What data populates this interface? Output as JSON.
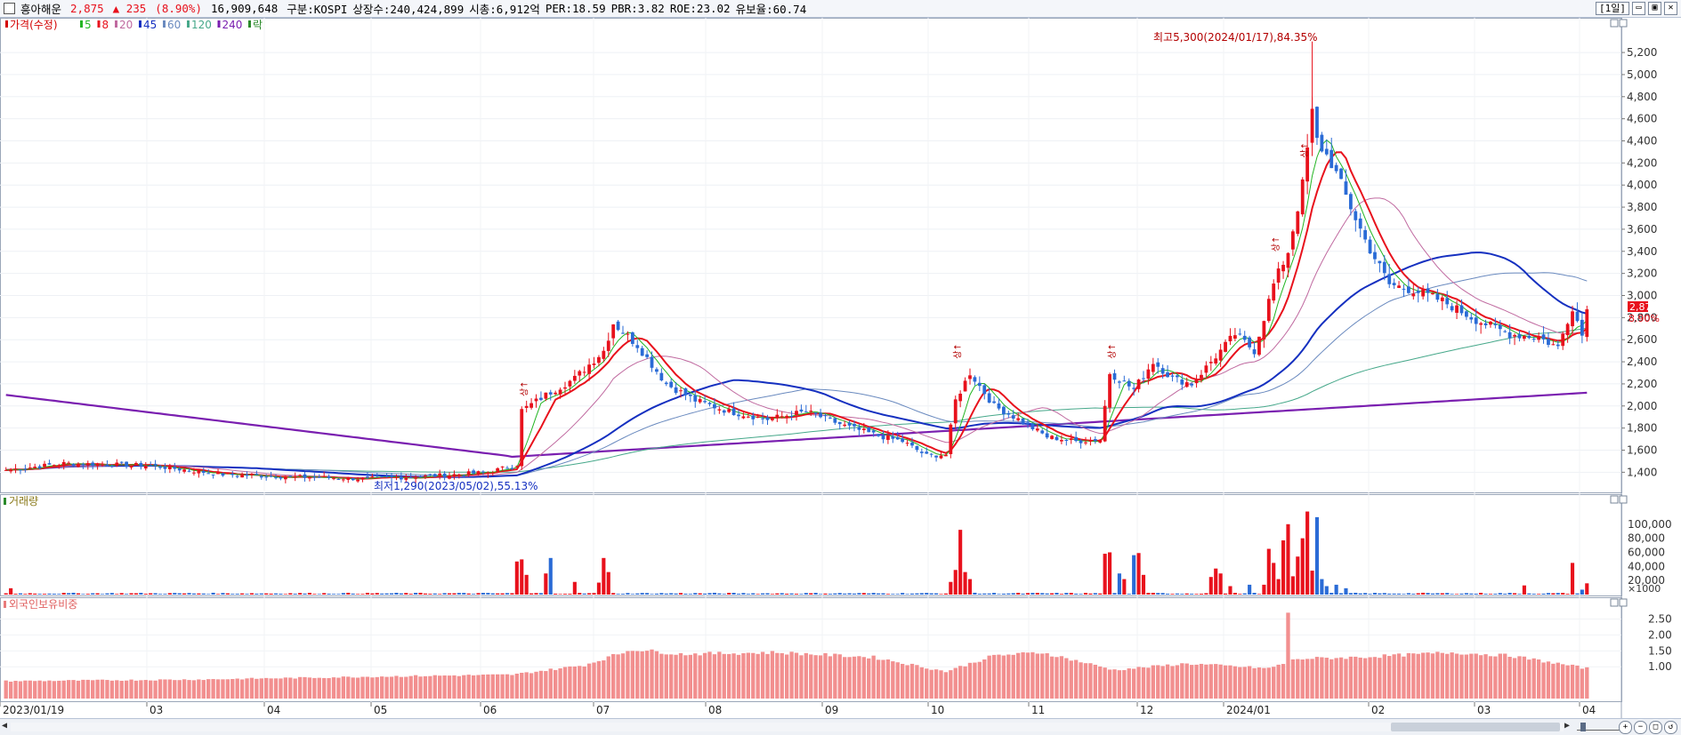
{
  "header": {
    "stock_name": "흥아해운",
    "price": "2,875",
    "change": "▲ 235",
    "change_pct": "(8.90%)",
    "volume": "16,909,648",
    "market": "구분:KOSPI",
    "shares": "상장수:240,424,899",
    "market_cap": "시총:6,912억",
    "per": "PER:18.59",
    "pbr": "PBR:3.82",
    "roe": "ROE:23.02",
    "float_ratio": "유보율:60.74",
    "timeframe": "[1일]",
    "window_buttons": [
      "▭",
      "▣",
      "✕"
    ]
  },
  "legend": {
    "items": [
      {
        "label": "가격(수정)",
        "color": "#d40000"
      },
      {
        "label": "5",
        "color": "#23b523"
      },
      {
        "label": "8",
        "color": "#e8111c"
      },
      {
        "label": "20",
        "color": "#c06aa0"
      },
      {
        "label": "45",
        "color": "#1530c0"
      },
      {
        "label": "60",
        "color": "#6a8abf"
      },
      {
        "label": "120",
        "color": "#46a88a"
      },
      {
        "label": "240",
        "color": "#7a1fb0"
      },
      {
        "label": "락",
        "color": "#2b8a2b"
      }
    ]
  },
  "annotations": {
    "high": "최고5,300(2024/01/17),84.35%",
    "low": "최저1,290(2023/05/02),55.13%",
    "limit_up": "상↑"
  },
  "last_price": {
    "price": "2,875",
    "pct": "8.90%"
  },
  "panels": {
    "volume_title": "거래량",
    "foreign_title": "외국인보유비중",
    "volume_unit": "×1000"
  },
  "x_axis": {
    "labels": [
      "2023/01/19",
      "03",
      "04",
      "05",
      "06",
      "07",
      "08",
      "09",
      "10",
      "11",
      "12",
      "2024/01",
      "02",
      "03",
      "04"
    ]
  },
  "price_axis": {
    "labels": [
      "5,200",
      "5,000",
      "4,800",
      "4,600",
      "4,400",
      "4,200",
      "4,000",
      "3,800",
      "3,600",
      "3,400",
      "3,200",
      "3,000",
      "2,800",
      "2,600",
      "2,400",
      "2,200",
      "2,000",
      "1,800",
      "1,600",
      "1,400"
    ]
  },
  "volume_axis": {
    "labels": [
      "100,000",
      "80,000",
      "60,000",
      "40,000",
      "20,000"
    ]
  },
  "foreign_axis": {
    "labels": [
      "2.50",
      "2.00",
      "1.50",
      "1.00"
    ]
  },
  "chart_data": {
    "type": "candlestick",
    "x_range": [
      "2023/01/19",
      "2024/04"
    ],
    "price_ylim": [
      1250,
      5450
    ],
    "price_anchors": [
      {
        "i": 0,
        "close": 1420
      },
      {
        "i": 12,
        "close": 1480
      },
      {
        "i": 30,
        "close": 1460
      },
      {
        "i": 45,
        "close": 1380
      },
      {
        "i": 58,
        "close": 1360
      },
      {
        "i": 75,
        "close": 1340
      },
      {
        "i": 90,
        "close": 1370
      },
      {
        "i": 100,
        "close": 1400
      },
      {
        "i": 106,
        "close": 1470
      },
      {
        "i": 107,
        "close": 1960
      },
      {
        "i": 112,
        "close": 2100
      },
      {
        "i": 118,
        "close": 2250
      },
      {
        "i": 124,
        "close": 2500
      },
      {
        "i": 126,
        "close": 2750
      },
      {
        "i": 131,
        "close": 2550
      },
      {
        "i": 137,
        "close": 2200
      },
      {
        "i": 143,
        "close": 2050
      },
      {
        "i": 150,
        "close": 1950
      },
      {
        "i": 158,
        "close": 1880
      },
      {
        "i": 166,
        "close": 1950
      },
      {
        "i": 174,
        "close": 1820
      },
      {
        "i": 181,
        "close": 1730
      },
      {
        "i": 186,
        "close": 1680
      },
      {
        "i": 191,
        "close": 1550
      },
      {
        "i": 195,
        "close": 1560
      },
      {
        "i": 197,
        "close": 2050
      },
      {
        "i": 200,
        "close": 2300
      },
      {
        "i": 205,
        "close": 2000
      },
      {
        "i": 210,
        "close": 1880
      },
      {
        "i": 216,
        "close": 1720
      },
      {
        "i": 222,
        "close": 1680
      },
      {
        "i": 227,
        "close": 1700
      },
      {
        "i": 229,
        "close": 2300
      },
      {
        "i": 234,
        "close": 2150
      },
      {
        "i": 238,
        "close": 2400
      },
      {
        "i": 242,
        "close": 2250
      },
      {
        "i": 246,
        "close": 2200
      },
      {
        "i": 251,
        "close": 2450
      },
      {
        "i": 255,
        "close": 2650
      },
      {
        "i": 259,
        "close": 2500
      },
      {
        "i": 263,
        "close": 3100
      },
      {
        "i": 266,
        "close": 3400
      },
      {
        "i": 269,
        "close": 4000
      },
      {
        "i": 271,
        "close": 4650
      },
      {
        "i": 272,
        "close": 4400
      },
      {
        "i": 275,
        "close": 4200
      },
      {
        "i": 278,
        "close": 3900
      },
      {
        "i": 282,
        "close": 3500
      },
      {
        "i": 287,
        "close": 3100
      },
      {
        "i": 292,
        "close": 3050
      },
      {
        "i": 298,
        "close": 2950
      },
      {
        "i": 305,
        "close": 2780
      },
      {
        "i": 312,
        "close": 2650
      },
      {
        "i": 318,
        "close": 2620
      },
      {
        "i": 322,
        "close": 2530
      },
      {
        "i": 325,
        "close": 2900
      },
      {
        "i": 327,
        "close": 2640
      },
      {
        "i": 328,
        "close": 2875
      }
    ],
    "bar_count": 329,
    "volume_ylim": [
      0,
      125000
    ],
    "volume_spikes": [
      {
        "i": 1,
        "v": 9000
      },
      {
        "i": 106,
        "v": 47000
      },
      {
        "i": 107,
        "v": 50000
      },
      {
        "i": 108,
        "v": 28000
      },
      {
        "i": 112,
        "v": 30000
      },
      {
        "i": 113,
        "v": 52000
      },
      {
        "i": 118,
        "v": 18000
      },
      {
        "i": 123,
        "v": 17000
      },
      {
        "i": 124,
        "v": 52000
      },
      {
        "i": 125,
        "v": 32000
      },
      {
        "i": 196,
        "v": 18000
      },
      {
        "i": 197,
        "v": 35000
      },
      {
        "i": 198,
        "v": 92000
      },
      {
        "i": 199,
        "v": 32000
      },
      {
        "i": 200,
        "v": 22000
      },
      {
        "i": 228,
        "v": 58000
      },
      {
        "i": 229,
        "v": 60000
      },
      {
        "i": 231,
        "v": 30000
      },
      {
        "i": 232,
        "v": 22000
      },
      {
        "i": 234,
        "v": 56000
      },
      {
        "i": 235,
        "v": 59000
      },
      {
        "i": 236,
        "v": 28000
      },
      {
        "i": 250,
        "v": 25000
      },
      {
        "i": 251,
        "v": 37000
      },
      {
        "i": 252,
        "v": 30000
      },
      {
        "i": 254,
        "v": 12000
      },
      {
        "i": 258,
        "v": 14000
      },
      {
        "i": 261,
        "v": 14000
      },
      {
        "i": 262,
        "v": 65000
      },
      {
        "i": 263,
        "v": 45000
      },
      {
        "i": 264,
        "v": 22000
      },
      {
        "i": 265,
        "v": 77000
      },
      {
        "i": 266,
        "v": 100000
      },
      {
        "i": 267,
        "v": 26000
      },
      {
        "i": 268,
        "v": 54000
      },
      {
        "i": 269,
        "v": 80000
      },
      {
        "i": 270,
        "v": 118000
      },
      {
        "i": 271,
        "v": 34000
      },
      {
        "i": 272,
        "v": 110000
      },
      {
        "i": 273,
        "v": 22000
      },
      {
        "i": 274,
        "v": 12000
      },
      {
        "i": 276,
        "v": 14000
      },
      {
        "i": 278,
        "v": 9000
      },
      {
        "i": 315,
        "v": 13000
      },
      {
        "i": 325,
        "v": 45000
      },
      {
        "i": 327,
        "v": 7000
      },
      {
        "i": 328,
        "v": 16000
      }
    ],
    "foreign_ylim": [
      0.0,
      2.85
    ],
    "foreign_anchors": [
      {
        "i": 0,
        "v": 0.55
      },
      {
        "i": 40,
        "v": 0.6
      },
      {
        "i": 80,
        "v": 0.7
      },
      {
        "i": 105,
        "v": 0.75
      },
      {
        "i": 120,
        "v": 1.05
      },
      {
        "i": 130,
        "v": 1.55
      },
      {
        "i": 140,
        "v": 1.4
      },
      {
        "i": 160,
        "v": 1.45
      },
      {
        "i": 180,
        "v": 1.3
      },
      {
        "i": 195,
        "v": 0.85
      },
      {
        "i": 205,
        "v": 1.35
      },
      {
        "i": 215,
        "v": 1.45
      },
      {
        "i": 230,
        "v": 0.9
      },
      {
        "i": 245,
        "v": 1.1
      },
      {
        "i": 262,
        "v": 0.95
      },
      {
        "i": 268,
        "v": 1.25
      },
      {
        "i": 281,
        "v": 1.3
      },
      {
        "i": 300,
        "v": 1.45
      },
      {
        "i": 312,
        "v": 1.35
      },
      {
        "i": 328,
        "v": 0.95
      }
    ],
    "foreign_spike": {
      "i": 266,
      "v": 2.7
    }
  }
}
